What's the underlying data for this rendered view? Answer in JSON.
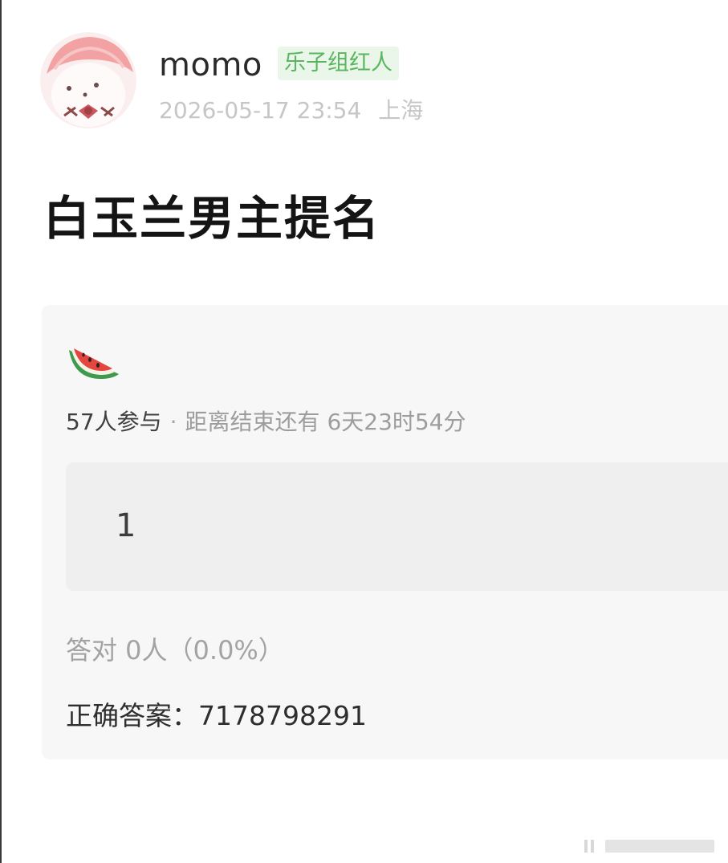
{
  "post": {
    "author": {
      "name": "momo",
      "badge": "乐子组红人",
      "avatar": "seal-plush-avatar"
    },
    "date": "2026-05-17 23:54",
    "location": "上海",
    "title": "白玉兰男主提名"
  },
  "quiz": {
    "icon": "watermelon-icon",
    "participants": "57人参与",
    "separator": "·",
    "remaining": "距离结束还有 6天23时54分",
    "option": "1",
    "correct_stats": "答对  0人（0.0%）",
    "answer": "正确答案：7178798291"
  },
  "colors": {
    "badge_bg": "#eaf6ea",
    "badge_text": "#59b65e",
    "card_bg": "#f7f7f7",
    "option_bg": "#efefef",
    "watermelon_red": "#e2463f",
    "watermelon_rind": "#3e9b4e"
  }
}
